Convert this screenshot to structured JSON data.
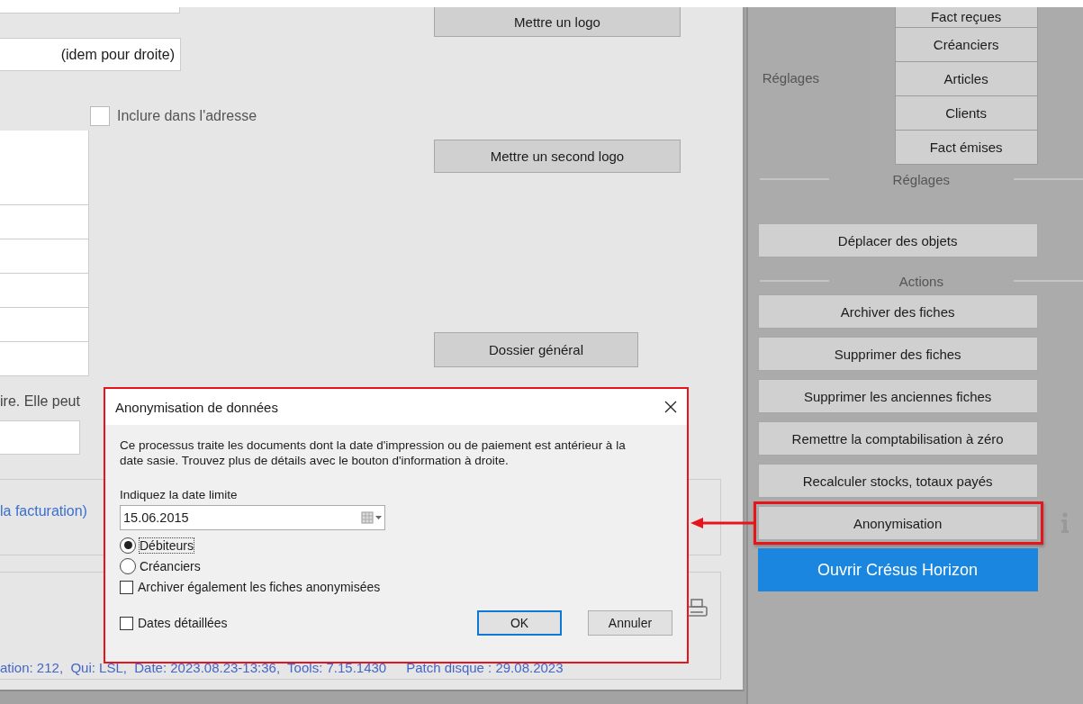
{
  "form": {
    "mirror_field": {
      "value": "(idem pour droite)"
    },
    "address_option": {
      "label": "Inclure dans l'adresse",
      "checked": false
    },
    "buttons": [
      "Mettre un logo",
      "Mettre un second logo",
      "Dossier général"
    ],
    "note": "ire. Elle peut",
    "link": "la facturation)",
    "status_line": [
      "ation: 212,  Qui: LSL,  Date: 2023.08.23-13:36,  Tools: 7.15.1430",
      "Patch disque : 29.08.2023"
    ]
  },
  "sidebar": {
    "tabs_label": "Réglages",
    "tabs": [
      "Fact reçues",
      "Créanciers",
      "Articles",
      "Clients",
      "Fact émises"
    ],
    "settings_section": "Réglages",
    "settings_buttons": [
      {
        "label": "Déplacer des objets"
      }
    ],
    "actions_section": "Actions",
    "actions": [
      {
        "label": "Archiver des fiches",
        "kind": "normal",
        "highlighted": false
      },
      {
        "label": "Supprimer des fiches",
        "kind": "normal",
        "highlighted": false
      },
      {
        "label": "Supprimer les anciennes fiches",
        "kind": "normal",
        "highlighted": false
      },
      {
        "label": "Remettre la comptabilisation à zéro",
        "kind": "normal",
        "highlighted": false
      },
      {
        "label": "Recalculer stocks, totaux payés",
        "kind": "normal",
        "highlighted": false
      },
      {
        "label": "Anonymisation",
        "kind": "info",
        "highlighted": true
      },
      {
        "label": "Ouvrir Crésus Horizon",
        "kind": "primary",
        "highlighted": false
      }
    ]
  },
  "dialog": {
    "title": "Anonymisation de données",
    "description": "Ce processus traite les documents dont la date d'impression ou de paiement est antérieur à la date sasie. Trouvez plus de détails avec le bouton d'information à droite.",
    "date_label": "Indiquez la date limite",
    "date_value": "15.06.2015",
    "radios": [
      {
        "label": "Débiteurs",
        "selected": true
      },
      {
        "label": "Créanciers",
        "selected": false
      }
    ],
    "archive_option": {
      "label": "Archiver également les fiches anonymisées",
      "checked": false
    },
    "detail_option": {
      "label": "Dates détaillées",
      "checked": false
    },
    "buttons": [
      {
        "label": "OK",
        "default": true
      },
      {
        "label": "Annuler",
        "default": false
      }
    ]
  }
}
